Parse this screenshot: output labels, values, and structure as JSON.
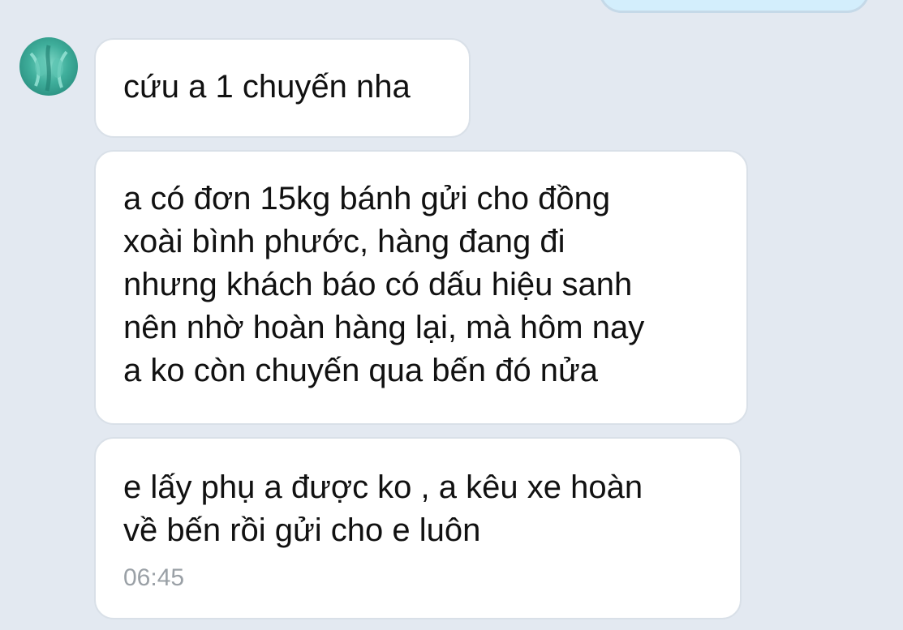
{
  "chat": {
    "messages": [
      {
        "lines": [
          "cứu a 1 chuyến nha"
        ]
      },
      {
        "lines": [
          "a có đơn 15kg bánh gửi cho đồng",
          "xoài bình phước, hàng đang đi",
          "nhưng khách báo có dấu hiệu sanh",
          "nên nhờ hoàn hàng lại, mà hôm nay",
          "a ko còn chuyến qua bến đó nửa"
        ]
      },
      {
        "lines": [
          "e lấy phụ a được ko , a kêu xe hoàn",
          "về bến rồi gửi cho e luôn"
        ],
        "time": "06:45"
      }
    ]
  },
  "colors": {
    "background": "#e3e9f1",
    "incoming_bubble": "#ffffff",
    "outgoing_bubble": "#d3eefc",
    "avatar": "#3fae9b",
    "timestamp": "#9aa0a6"
  }
}
